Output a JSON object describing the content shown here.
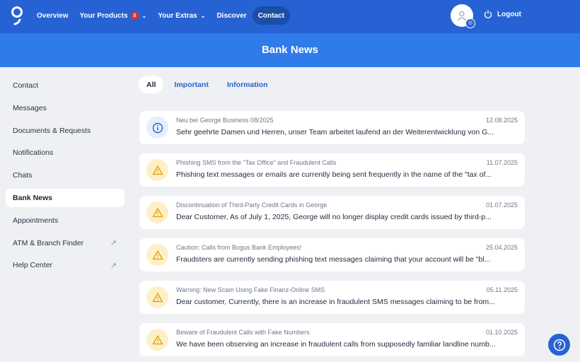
{
  "header": {
    "nav": [
      {
        "label": "Overview"
      },
      {
        "label": "Your Products",
        "badge": "3"
      },
      {
        "label": "Your Extras"
      },
      {
        "label": "Discover"
      },
      {
        "label": "Contact"
      }
    ],
    "logout": "Logout"
  },
  "page_title": "Bank News",
  "sidebar": {
    "items": [
      {
        "label": "Contact"
      },
      {
        "label": "Messages"
      },
      {
        "label": "Documents & Requests"
      },
      {
        "label": "Notifications"
      },
      {
        "label": "Chats"
      },
      {
        "label": "Bank News"
      },
      {
        "label": "Appointments"
      },
      {
        "label": "ATM & Branch Finder"
      },
      {
        "label": "Help Center"
      }
    ]
  },
  "tabs": [
    {
      "label": "All"
    },
    {
      "label": "Important"
    },
    {
      "label": "Information"
    }
  ],
  "news": [
    {
      "icon": "info",
      "title": "Neu bei George Business 08/2025",
      "date": "12.08.2025",
      "body": "Sehr geehrte Damen und Herren, unser Team arbeitet laufend an der Weiterentwicklung von G..."
    },
    {
      "icon": "warning",
      "title": "Phishing SMS from the \"Tax Office\" and Fraudulent Calls",
      "date": "11.07.2025",
      "body": "Phishing text messages or emails are currently being sent frequently in the name of the \"tax of..."
    },
    {
      "icon": "warning",
      "title": "Discontinuation of Third-Party Credit Cards in George",
      "date": "01.07.2025",
      "body": "Dear Customer, As of July 1, 2025, George will no longer display credit cards issued by third-p..."
    },
    {
      "icon": "warning",
      "title": "Caution: Calls from Bogus Bank Employees!",
      "date": "25.04.2025",
      "body": "Fraudsters are currently sending phishing text messages claiming that your account will be \"bl..."
    },
    {
      "icon": "warning",
      "title": "Warning: New Scam Using Fake Finanz-Online SMS",
      "date": "05.11.2025",
      "body": "Dear customer, Currently, there is an increase in fraudulent SMS messages claiming to be from..."
    },
    {
      "icon": "warning",
      "title": "Beware of Fraudulent Calls with Fake Numbers",
      "date": "01.10.2025",
      "body": "We have been observing an increase in fraudulent calls from supposedly familiar landline numb..."
    }
  ],
  "colors": {
    "primary": "#2762d4",
    "band": "#2f7be9",
    "warning": "#e0a100"
  }
}
